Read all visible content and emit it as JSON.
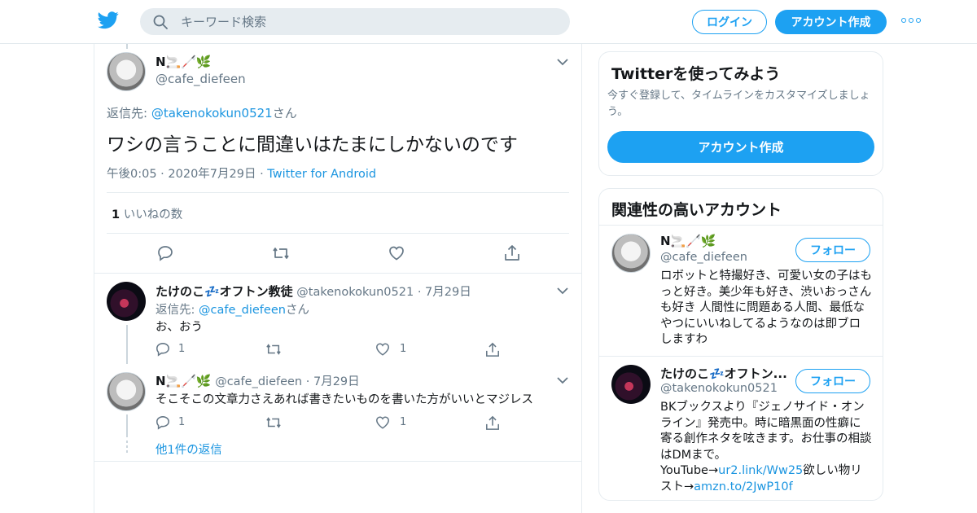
{
  "header": {
    "search_placeholder": "キーワード検索",
    "login_label": "ログイン",
    "signup_label": "アカウント作成",
    "more_icon": "more-dots-icon",
    "logo_icon": "twitter-bird-icon"
  },
  "main_tweet": {
    "author_name": "N🚬🦯🌿",
    "author_handle": "@cafe_diefeen",
    "reply_prefix": "返信先: ",
    "reply_to": "@takenokokun0521",
    "reply_suffix": "さん",
    "text": "ワシの言うことに間違いはたまにしかないのです",
    "time": "午後0:05",
    "date": "2020年7月29日",
    "source": "Twitter for Android",
    "like_count": "1",
    "like_label": "いいねの数"
  },
  "replies": [
    {
      "author_name": "たけのこ💤オフトン教徒",
      "author_handle": "@takenokokun0521",
      "date": "7月29日",
      "reply_prefix": "返信先: ",
      "reply_to": "@cafe_diefeen",
      "reply_suffix": "さん",
      "text": "お、おう",
      "reply_count": "1",
      "like_count": "1"
    },
    {
      "author_name": "N🚬🦯🌿",
      "author_handle": "@cafe_diefeen",
      "date": "7月29日",
      "text": "そこそこの文章力さえあれば書きたいものを書いた方がいいとマジレス",
      "reply_count": "1",
      "like_count": "1"
    }
  ],
  "more_replies_label": "他1件の返信",
  "signup_card": {
    "title": "Twitterを使ってみよう",
    "description": "今すぐ登録して、タイムラインをカスタマイズしましょう。",
    "button_label": "アカウント作成"
  },
  "related_card": {
    "title": "関連性の高いアカウント",
    "follow_label": "フォロー",
    "accounts": [
      {
        "name": "N🚬🦯🌿",
        "handle": "@cafe_diefeen",
        "bio": "ロボットと特撮好き、可愛い女の子はもっと好き。美少年も好き、渋いおっさんも好き 人間性に問題ある人間、最低なやつにいいねしてるようなのは即ブロしますわ"
      },
      {
        "name": "たけのこ💤オフトン...",
        "handle": "@takenokokun0521",
        "bio_main": "BKブックスより『ジェノサイド・オンライン』発売中。時に暗黒面の性癖に寄る創作ネタを呟きます。お仕事の相談はDMまで。",
        "bio_youtube_label": "YouTube→",
        "bio_youtube_link": "ur2.link/Ww25",
        "bio_wishlist_label": "欲しい物リスト→",
        "bio_wishlist_link": "amzn.to/2JwP10f"
      }
    ]
  },
  "colors": {
    "accent": "#1da1f2",
    "link": "#1b95e0",
    "muted": "#657786",
    "border": "#e6ecf0"
  }
}
